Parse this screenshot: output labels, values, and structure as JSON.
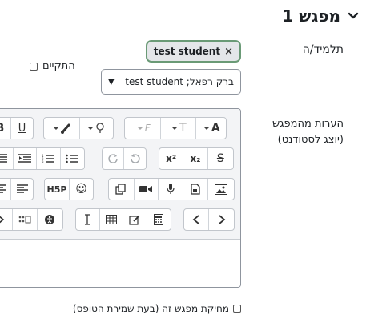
{
  "header": {
    "title": "מפגש 1"
  },
  "student": {
    "label": "תלמיד/ה",
    "chip": "test student",
    "chip_remove": "×",
    "held_label": "התקיים",
    "select_value": "ברק רפאל; test student"
  },
  "notes": {
    "label_line1": "הערות מהמפגש",
    "label_line2": "(יוצג לסטודנט)"
  },
  "toolbar": {
    "underline": "U",
    "strike": "S",
    "font_a": "A",
    "font_t": "T",
    "font_f": "F",
    "superscript": "x²",
    "subscript": "x₂",
    "h5p": "H5P",
    "emoji": "☺"
  },
  "footer": {
    "delete_label": "מחיקת מפגש זה (בעת שמירת הטופס)"
  },
  "colors": {
    "accent": "#0f6cbf",
    "chip_border": "#6a9a76"
  }
}
